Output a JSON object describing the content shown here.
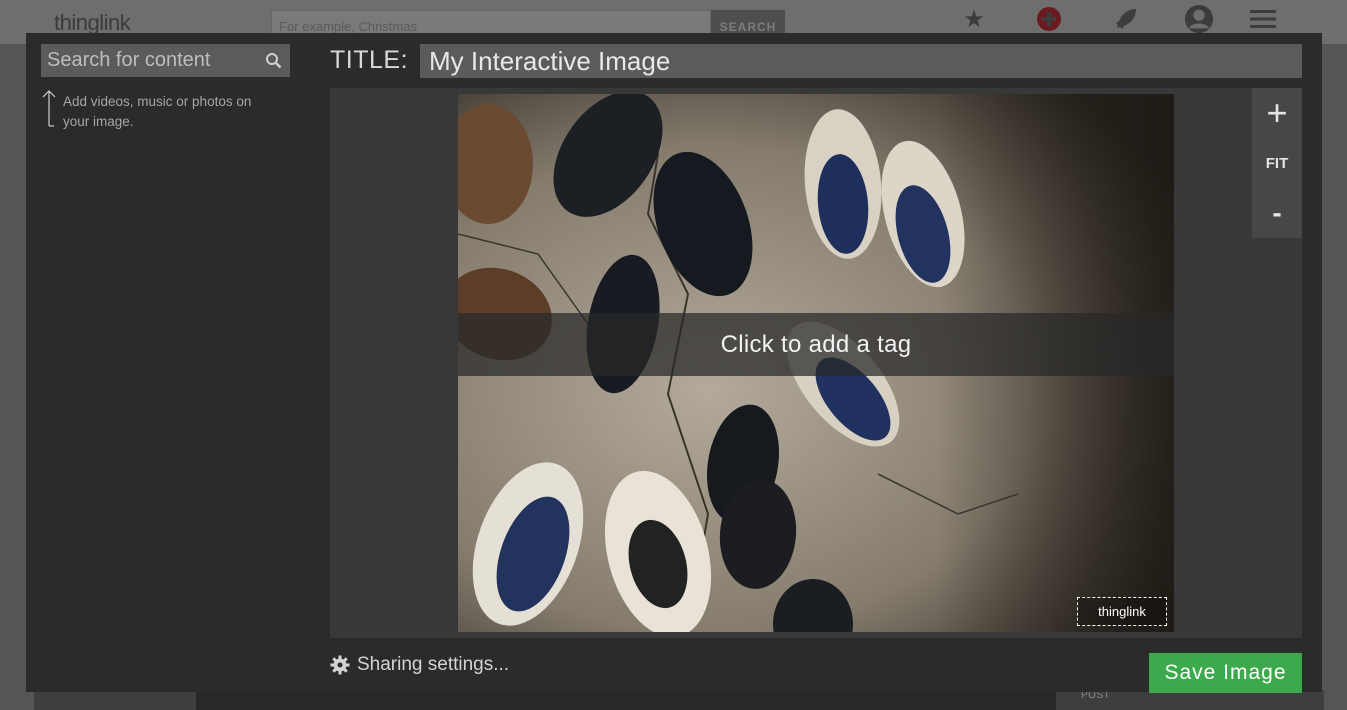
{
  "background": {
    "logo": "thinglink",
    "search_placeholder": "For example, Christmas",
    "search_button": "SEARCH",
    "post_label": "POST",
    "icons": [
      "star-icon",
      "add-icon",
      "rocket-icon",
      "user-icon",
      "menu-icon"
    ]
  },
  "sidebar": {
    "search_placeholder": "Search for content",
    "hint": "Add videos, music or photos on your image."
  },
  "editor": {
    "title_label": "TITLE:",
    "title_value": "My Interactive Image",
    "tag_prompt": "Click to add a tag",
    "watermark": "thinglink",
    "zoom_in": "+",
    "zoom_fit": "FIT",
    "zoom_out": "-"
  },
  "footer": {
    "sharing_label": "Sharing settings...",
    "save_label": "Save Image"
  },
  "colors": {
    "save_green": "#3caa4c",
    "modal_bg": "#2b2b2b",
    "add_red": "#c8102e"
  }
}
